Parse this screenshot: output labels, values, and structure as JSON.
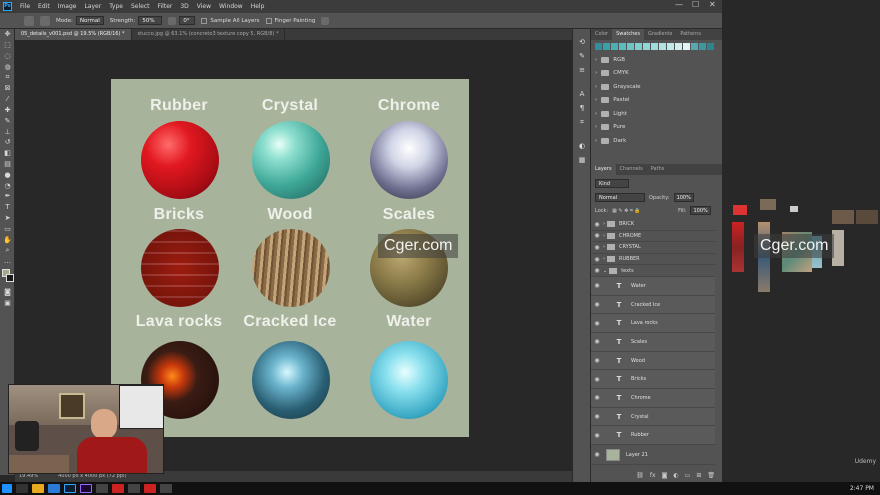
{
  "menu": [
    "File",
    "Edit",
    "Image",
    "Layer",
    "Type",
    "Select",
    "Filter",
    "3D",
    "View",
    "Window",
    "Help"
  ],
  "window_buttons": [
    "—",
    "☐",
    "✕"
  ],
  "options": {
    "mode_label": "Mode:",
    "mode_value": "Normal",
    "strength_label": "Strength:",
    "strength_value": "50%",
    "angle_value": "0°",
    "sample_all_layers": "Sample All Layers",
    "finger_painting": "Finger Painting"
  },
  "tabs": [
    {
      "label": "05_details_v001.psd @ 19.5% (RGB/16) *",
      "active": true
    },
    {
      "label": "stucco.jpg @ 63.1% (concreto3 texture copy 5, RGB/8) *",
      "active": false
    }
  ],
  "materials": [
    {
      "label": "Rubber"
    },
    {
      "label": "Crystal"
    },
    {
      "label": "Chrome"
    },
    {
      "label": "Bricks"
    },
    {
      "label": "Wood"
    },
    {
      "label": "Scales"
    },
    {
      "label": "Lava rocks"
    },
    {
      "label": "Cracked Ice"
    },
    {
      "label": "Water"
    }
  ],
  "status": {
    "zoom": "19.49%",
    "doc": "4000 px x 4000 px (72 ppi)"
  },
  "color_panel": {
    "tabs": [
      "Color",
      "Swatches",
      "Gradients",
      "Patterns"
    ],
    "active_tab": "Swatches",
    "swatch_colors": [
      "#2f8f9a",
      "#3aa0a8",
      "#4bb0b3",
      "#5bbcc0",
      "#6cc6c8",
      "#7ecfd0",
      "#8fd6d6",
      "#a0dcdc",
      "#b2e2e2",
      "#c2e8e8",
      "#d3eeee",
      "#e2f4f4",
      "#56a9b0",
      "#3f97a0",
      "#2d868f"
    ],
    "groups": [
      "RGB",
      "CMYK",
      "Grayscale",
      "Pastel",
      "Light",
      "Pure",
      "Dark"
    ]
  },
  "layers_panel": {
    "tabs": [
      "Layers",
      "Channels",
      "Paths"
    ],
    "active_tab": "Layers",
    "filter_kind": "Kind",
    "blend_mode": "Normal",
    "opacity_label": "Opacity:",
    "opacity_value": "100%",
    "lock_label": "Lock:",
    "fill_label": "Fill:",
    "fill_value": "100%",
    "groups": [
      "BRICK",
      "CHROME",
      "CRYSTAL",
      "RUBBER",
      "texts"
    ],
    "text_layers": [
      "Water",
      "Cracked Ice",
      "Lava rocks",
      "Scales",
      "Wood",
      "Bricks",
      "Chrome",
      "Crystal",
      "Rubber"
    ],
    "bottom_layer": "Layer 21"
  },
  "watermark": "Cger.com",
  "clock": "2:47 PM",
  "udemy": "Udemy"
}
